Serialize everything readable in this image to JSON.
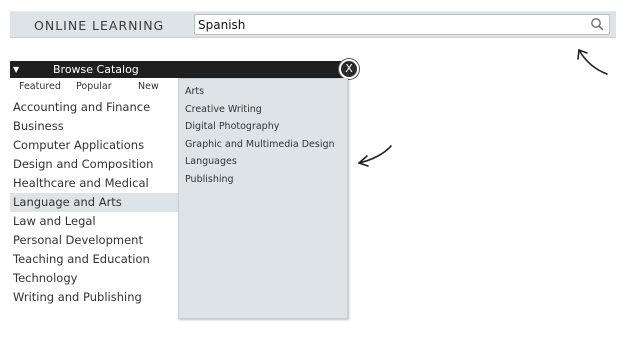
{
  "header": {
    "brand": "ONLINE LEARNING",
    "search": {
      "value": "Spanish"
    }
  },
  "catalog": {
    "title": "Browse Catalog",
    "close_label": "X",
    "tabs": [
      "Featured",
      "Popular",
      "New"
    ],
    "categories": [
      "Accounting and Finance",
      "Business",
      "Computer Applications",
      "Design and Composition",
      "Healthcare and Medical",
      "Language and Arts",
      "Law and Legal",
      "Personal Development",
      "Teaching and Education",
      "Technology",
      "Writing and Publishing"
    ],
    "selected_category": "Language and Arts",
    "subcategories": [
      "Arts",
      "Creative Writing",
      "Digital Photography",
      "Graphic and Multimedia Design",
      "Languages",
      "Publishing"
    ]
  },
  "colors": {
    "bar_bg": "#dde3e7",
    "header_dark": "#1f1f1f",
    "panel_bg": "#dde3e7"
  },
  "icons": [
    "search-icon",
    "caret-down-icon",
    "close-icon",
    "arrow-icon"
  ]
}
